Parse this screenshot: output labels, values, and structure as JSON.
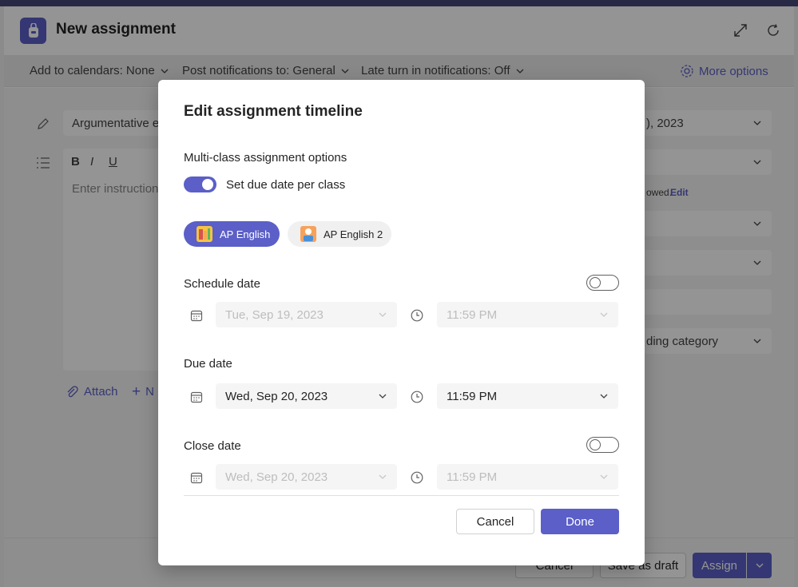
{
  "window": {
    "title": "New assignment",
    "icons": [
      "backpack-icon",
      "expand-icon",
      "refresh-icon"
    ]
  },
  "toolbar": {
    "calendars": "Add to calendars: None",
    "notifications": "Post notifications to: General",
    "late_turnin": "Late turn in notifications: Off",
    "more_options": "More options"
  },
  "background_form": {
    "title_value": "Argumentative es",
    "instructions_placeholder": "Enter instructions",
    "date_partial": "), 2023",
    "allowed_partial": "owed.",
    "edit_link": "Edit",
    "grading_partial": "ding category",
    "attach_label": "Attach",
    "new_partial": "N"
  },
  "footer": {
    "cancel": "Cancel",
    "save_draft": "Save as draft",
    "assign": "Assign"
  },
  "dialog": {
    "title": "Edit assignment timeline",
    "multiclass_heading": "Multi-class assignment options",
    "toggle_label": "Set due date per class",
    "classes": [
      {
        "name": "AP English",
        "selected": true
      },
      {
        "name": "AP English 2",
        "selected": false
      }
    ],
    "schedule": {
      "label": "Schedule date",
      "enabled": false,
      "date": "Tue, Sep 19, 2023",
      "time": "11:59 PM"
    },
    "due": {
      "label": "Due date",
      "date": "Wed, Sep 20, 2023",
      "time": "11:59 PM"
    },
    "close": {
      "label": "Close date",
      "enabled": false,
      "date": "Wed, Sep 20, 2023",
      "time": "11:59 PM"
    },
    "cancel": "Cancel",
    "done": "Done"
  },
  "colors": {
    "accent": "#5b5fc7",
    "header_strip": "#464775"
  }
}
